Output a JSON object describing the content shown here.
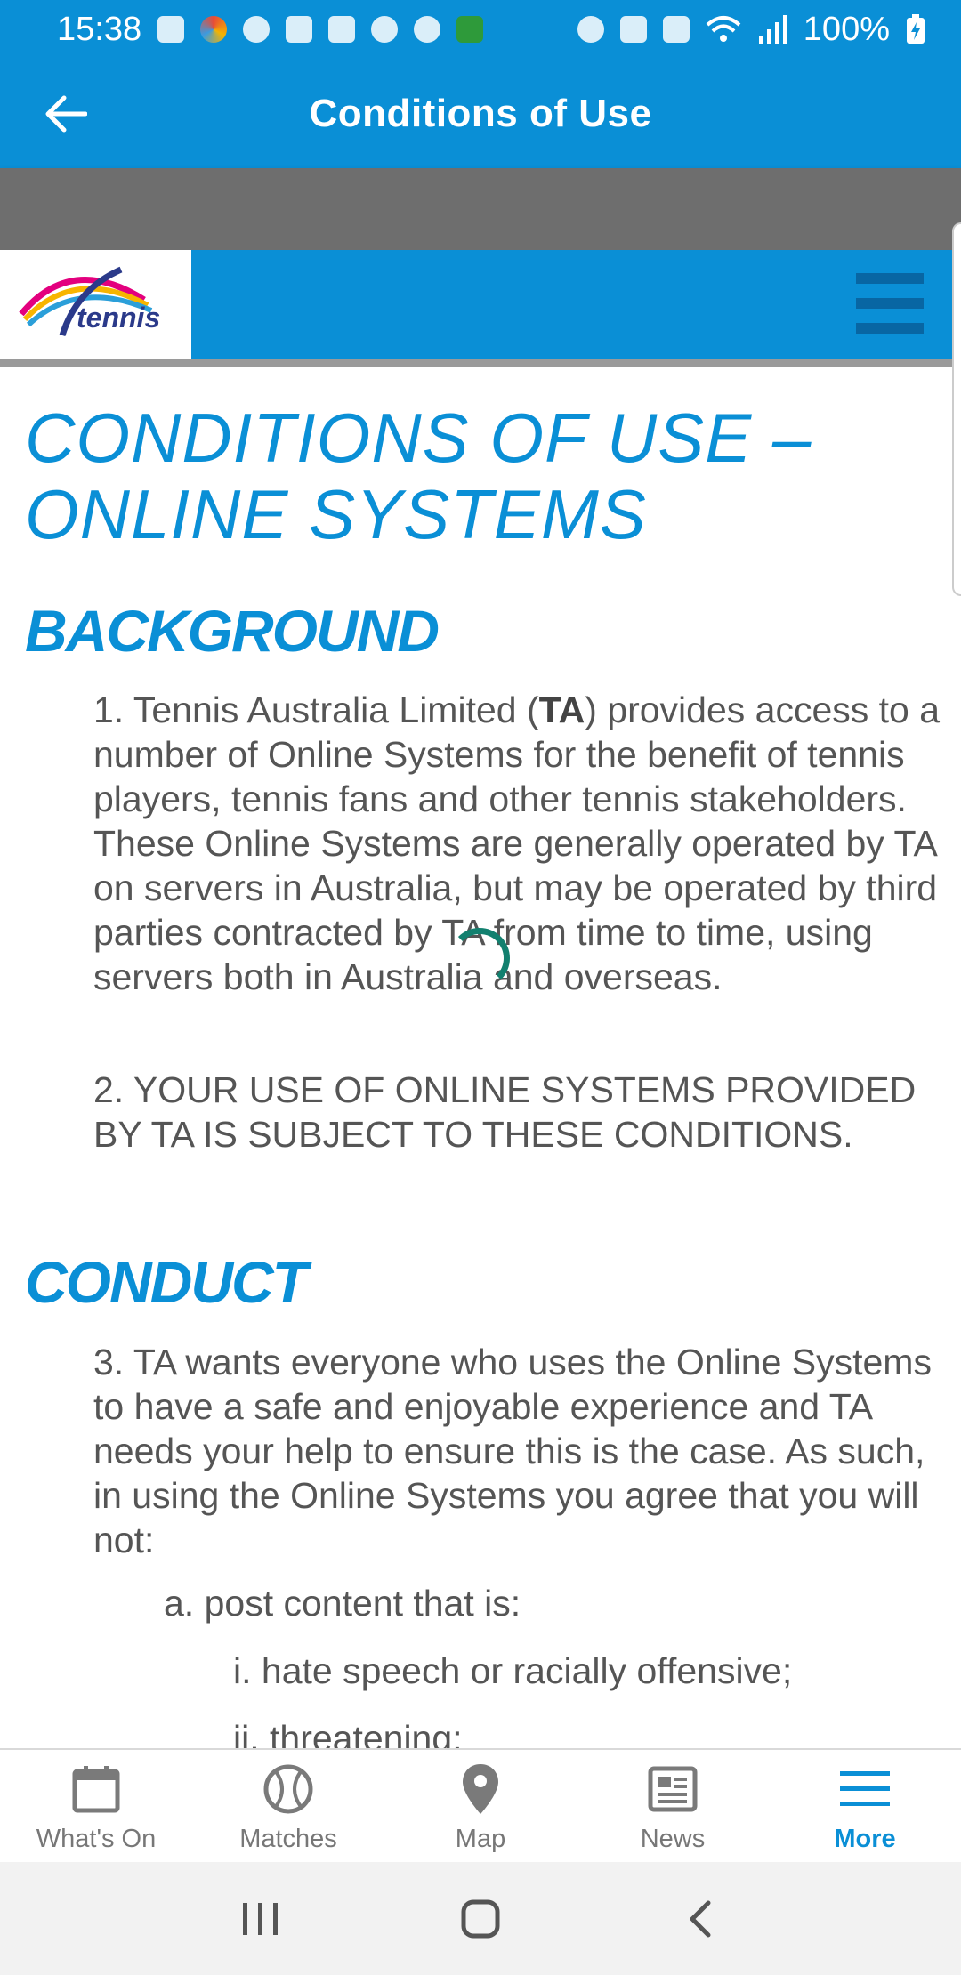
{
  "status_bar": {
    "time": "15:38",
    "battery": "100%",
    "icons_left": [
      "outlook-icon",
      "chrome-icon",
      "spotify-icon",
      "tasks-icon",
      "gmail-icon",
      "teams-icon",
      "pinwheel-icon",
      "australia-icon"
    ],
    "icons_right": [
      "alarm-icon",
      "mute-icon",
      "volte-icon",
      "wifi-icon",
      "signal-icon",
      "battery-charging-icon"
    ]
  },
  "app_bar": {
    "title": "Conditions of Use"
  },
  "site_header": {
    "logo_text": "tennis"
  },
  "content": {
    "page_title": "CONDITIONS OF USE – ONLINE SYSTEMS",
    "sections": [
      {
        "heading": "BACKGROUND",
        "paragraphs": [
          {
            "before": "1. Tennis Australia Limited (",
            "bold": "TA",
            "after": ") provides access to a number of Online Systems for the benefit of tennis players, tennis fans and other tennis stakeholders. These Online Systems are generally operated by TA on servers in Australia, but may be operated by third parties contracted by TA from time to time, using servers both in Australia and overseas."
          },
          {
            "text": "2. YOUR USE OF ONLINE SYSTEMS PROVIDED BY TA IS SUBJECT TO THESE CONDITIONS."
          }
        ]
      },
      {
        "heading": "CONDUCT",
        "paragraphs": [
          {
            "text": "3. TA wants everyone who uses the Online Systems to have a safe and enjoyable experience and TA needs your help to ensure this is the case. As such, in using the Online Systems you agree that you will not:"
          }
        ],
        "items": [
          "a. post content that is:",
          "i. hate speech or racially offensive;",
          "ii. threatening;"
        ]
      }
    ]
  },
  "bottom_nav": {
    "items": [
      {
        "label": "What's On",
        "icon": "calendar-icon"
      },
      {
        "label": "Matches",
        "icon": "tennis-ball-icon"
      },
      {
        "label": "Map",
        "icon": "map-pin-icon"
      },
      {
        "label": "News",
        "icon": "newspaper-icon"
      },
      {
        "label": "More",
        "icon": "menu-icon",
        "active": true
      }
    ]
  },
  "colors": {
    "brand_blue": "#0a8fd6",
    "text_gray": "#555555",
    "spinner_teal": "#12806f"
  }
}
